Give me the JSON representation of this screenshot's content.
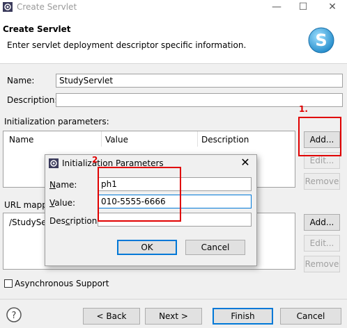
{
  "window": {
    "title": "Create Servlet"
  },
  "header": {
    "title": "Create Servlet",
    "description": "Enter servlet deployment descriptor specific information."
  },
  "form": {
    "name_label": "Name:",
    "name_value": "StudyServlet",
    "description_label": "Description:",
    "description_value": ""
  },
  "init_params": {
    "label": "Initialization parameters:",
    "columns": [
      "Name",
      "Value",
      "Description"
    ],
    "add_label": "Add...",
    "edit_label": "Edit...",
    "remove_label": "Remove"
  },
  "url_mappings": {
    "label": "URL mappi",
    "rows": [
      "/StudySer"
    ],
    "add_label": "Add...",
    "edit_label": "Edit...",
    "remove_label": "Remove"
  },
  "async": {
    "label": "Asynchronous Support",
    "checked": false
  },
  "dialog": {
    "title": "Initialization Parameters",
    "name_label_pre": "",
    "name_label_u": "N",
    "name_label_post": "ame:",
    "name_value": "ph1",
    "value_label_u": "V",
    "value_label_post": "alue:",
    "value_value": "010-5555-6666",
    "desc_label_pre": "Des",
    "desc_label_u": "c",
    "desc_label_post": "ription:",
    "desc_value": "",
    "ok_label": "OK",
    "cancel_label": "Cancel"
  },
  "footer": {
    "help": "?",
    "back_label": "< Back",
    "next_label": "Next >",
    "finish_label": "Finish",
    "cancel_label": "Cancel"
  },
  "annotations": {
    "step1": "1.",
    "step2": "2"
  },
  "colors": {
    "accent": "#0078d7",
    "annotation": "#e00000"
  }
}
